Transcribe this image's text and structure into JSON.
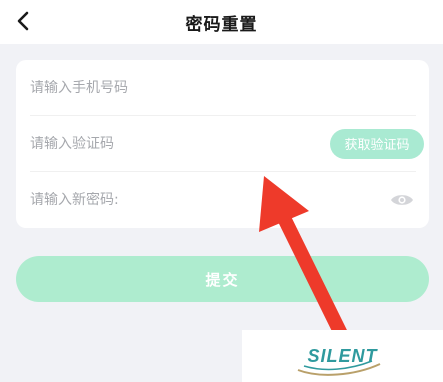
{
  "header": {
    "title": "密码重置",
    "back_icon": "chevron-left-icon"
  },
  "form": {
    "phone_placeholder": "请输入手机号码",
    "code_placeholder": "请输入验证码",
    "get_code_label": "获取验证码",
    "password_placeholder": "请输入新密码:",
    "eye_icon": "eye-icon"
  },
  "submit_label": "提交",
  "watermark": {
    "text": "SILENT"
  },
  "colors": {
    "accent_disabled": "#aeeccf",
    "background": "#f1f2f6",
    "annotation_arrow": "#ee3a2a"
  }
}
